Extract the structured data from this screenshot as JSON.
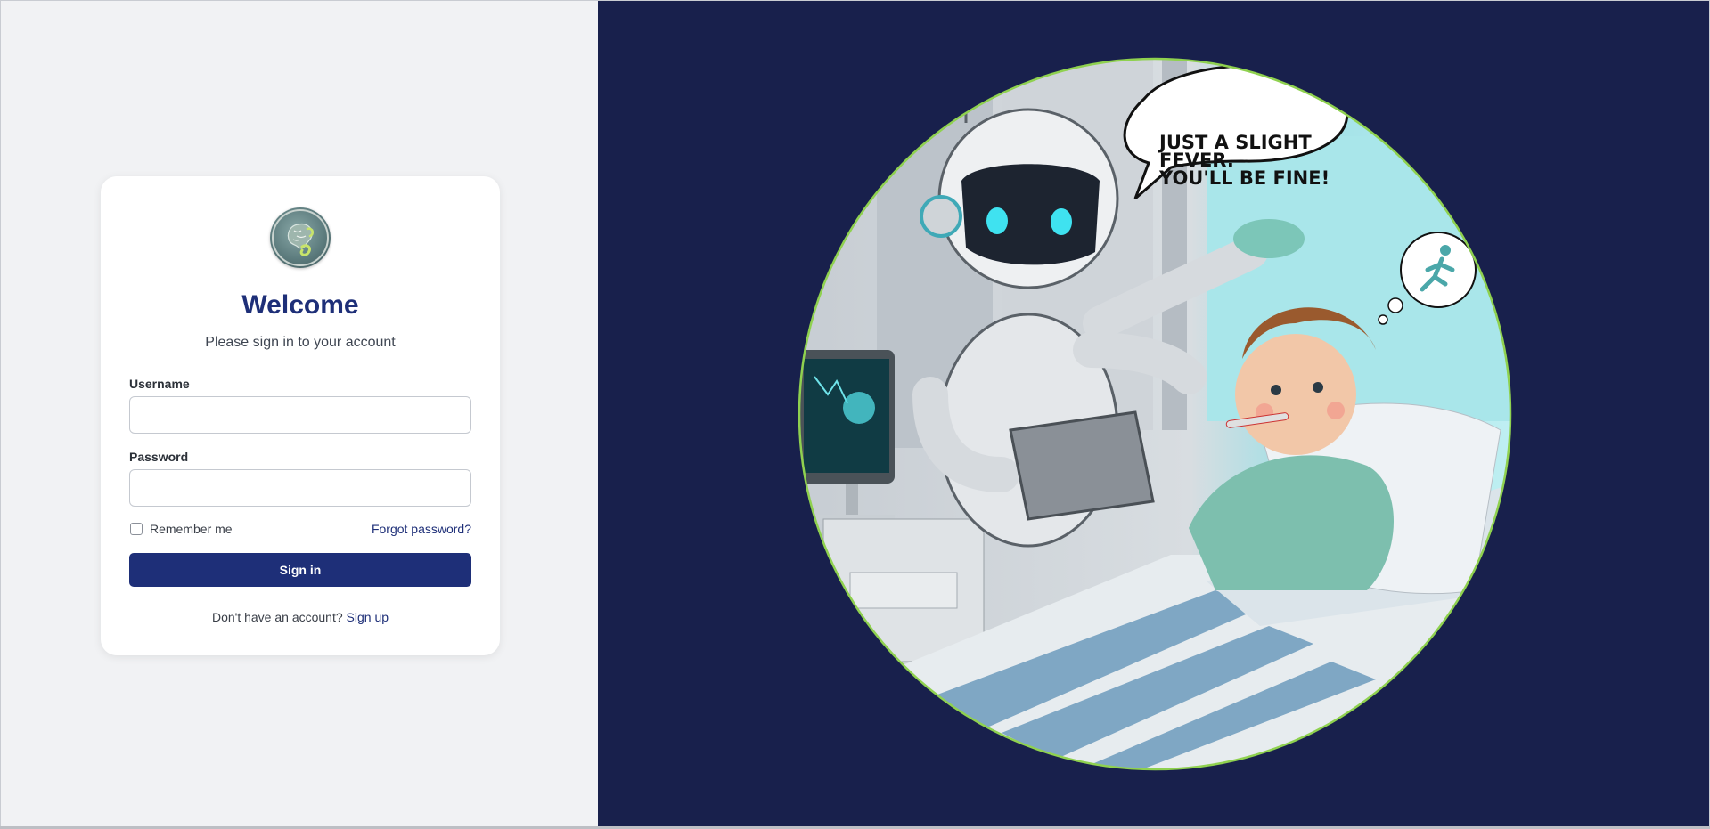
{
  "login": {
    "title": "Welcome",
    "subtitle": "Please sign in to your account",
    "username_label": "Username",
    "username_value": "",
    "password_label": "Password",
    "password_value": "",
    "remember_label": "Remember me",
    "remember_checked": false,
    "forgot_link": "Forgot password?",
    "signin_button": "Sign in",
    "signup_prompt": "Don't have an account?",
    "signup_link": "Sign up"
  },
  "illustration": {
    "speech_bubble_lines": [
      "JUST A SLIGHT",
      "FEVER.",
      "YOU'LL BE FINE!"
    ],
    "thought_icon": "running-person-icon"
  },
  "colors": {
    "brand": "#1e2f78",
    "right_background": "#18204c",
    "left_background": "#f1f2f4",
    "circle_border": "#8fd14f"
  }
}
